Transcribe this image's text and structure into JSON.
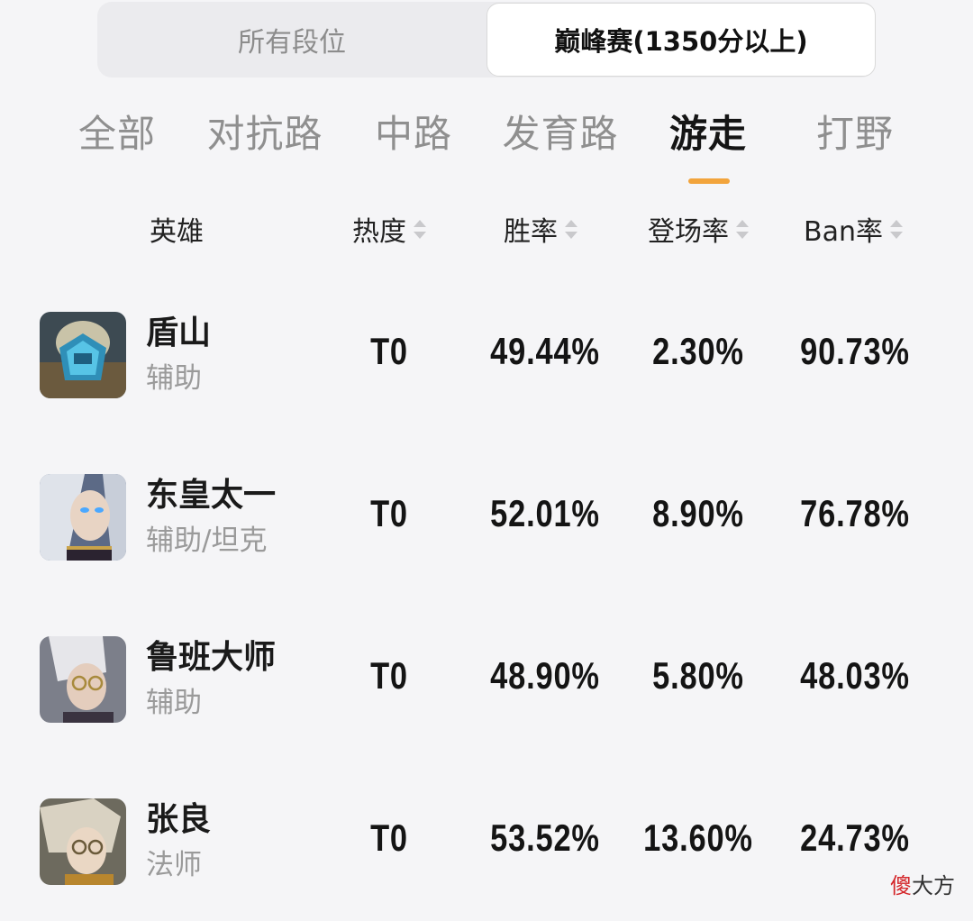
{
  "rank_tabs": {
    "all_label": "所有段位",
    "peak_label": "巅峰赛(1350分以上)"
  },
  "position_tabs": [
    {
      "label": "全部"
    },
    {
      "label": "对抗路"
    },
    {
      "label": "中路"
    },
    {
      "label": "发育路"
    },
    {
      "label": "游走",
      "active": true
    },
    {
      "label": "打野"
    }
  ],
  "columns": {
    "hero": "英雄",
    "heat": "热度",
    "win_rate": "胜率",
    "pick_rate": "登场率",
    "ban_rate": "Ban率"
  },
  "rows": [
    {
      "name": "盾山",
      "role": "辅助",
      "heat": "T0",
      "win_rate": "49.44%",
      "pick_rate": "2.30%",
      "ban_rate": "90.73%"
    },
    {
      "name": "东皇太一",
      "role": "辅助/坦克",
      "heat": "T0",
      "win_rate": "52.01%",
      "pick_rate": "8.90%",
      "ban_rate": "76.78%"
    },
    {
      "name": "鲁班大师",
      "role": "辅助",
      "heat": "T0",
      "win_rate": "48.90%",
      "pick_rate": "5.80%",
      "ban_rate": "48.03%"
    },
    {
      "name": "张良",
      "role": "法师",
      "heat": "T0",
      "win_rate": "53.52%",
      "pick_rate": "13.60%",
      "ban_rate": "24.73%"
    }
  ],
  "watermark": {
    "first_char": "傻",
    "rest": "大方"
  },
  "colors": {
    "accent_underline": "#f2a43c",
    "watermark_red": "#d4262a"
  }
}
